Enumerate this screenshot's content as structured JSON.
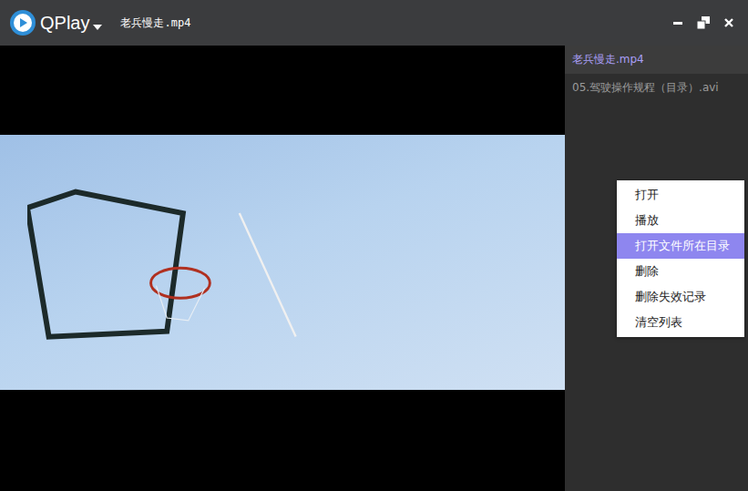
{
  "app": {
    "name": "QPlay"
  },
  "window": {
    "title": "老兵慢走.mp4"
  },
  "playlist": [
    {
      "label": "老兵慢走.mp4",
      "selected": true
    },
    {
      "label": "05.驾驶操作规程（目录）.avi",
      "selected": false
    }
  ],
  "context_menu": [
    {
      "label": "打开",
      "selected": false
    },
    {
      "label": "播放",
      "selected": false
    },
    {
      "label": "打开文件所在目录",
      "selected": true
    },
    {
      "label": "删除",
      "selected": false
    },
    {
      "label": "删除失效记录",
      "selected": false
    },
    {
      "label": "清空列表",
      "selected": false
    }
  ]
}
